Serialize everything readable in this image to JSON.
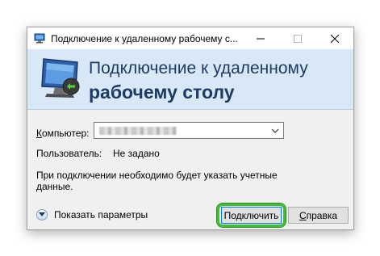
{
  "window": {
    "title": "Подключение к удаленному рабочему с...",
    "icon": "remote-desktop-icon",
    "controls": [
      "minimize-icon",
      "maximize-icon",
      "close-icon"
    ]
  },
  "banner": {
    "line1": "Подключение к удаленному",
    "line2": "рабочему столу",
    "icon": "remote-desktop-monitor-icon"
  },
  "form": {
    "computer_label_accel": "К",
    "computer_label_rest": "омпьютер:",
    "computer_value": "",
    "user_label": "Пользователь:",
    "user_value": "Не задано",
    "note": "При подключении необходимо будет указать учетные данные."
  },
  "footer": {
    "show_options_accel": "",
    "show_options_label": "Показать параметры",
    "connect_accel": "",
    "connect_label": "Подключить",
    "help_accel": "С",
    "help_rest": "правка"
  },
  "colors": {
    "banner_bg": "#d9e8f7",
    "banner_text": "#1e3b63",
    "highlight": "#3fbf2f"
  }
}
